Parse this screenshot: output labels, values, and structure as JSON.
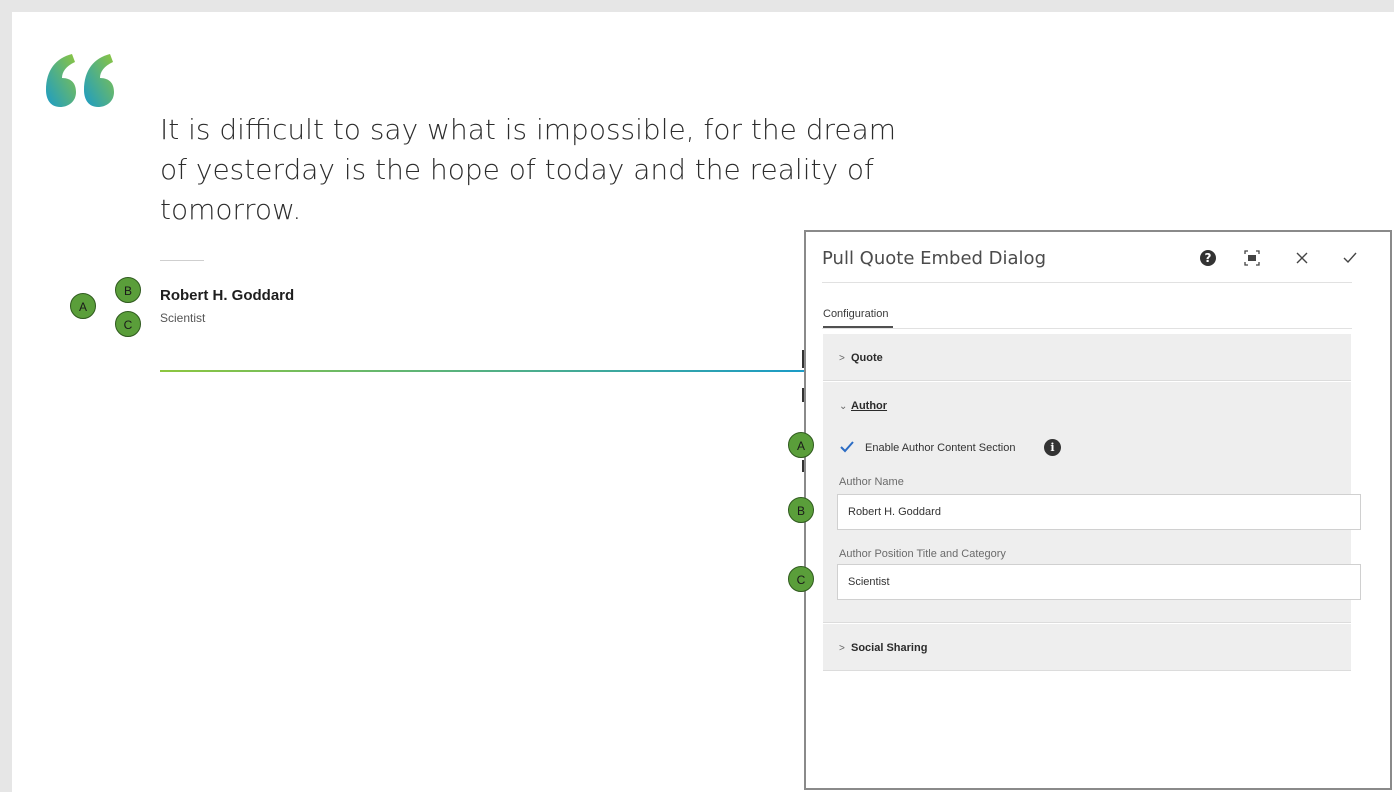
{
  "quote": {
    "text": "It is difficult to say what is impossible, for the dream of yesterday is the hope of today and the reality of tomorrow.",
    "author_name": "Robert H. Goddard",
    "author_title": "Scientist"
  },
  "callouts": {
    "a": "A",
    "b": "B",
    "c": "C"
  },
  "dialog": {
    "title": "Pull Quote Embed Dialog",
    "icons": {
      "help": "help-icon",
      "fullscreen": "fullscreen-icon",
      "close": "close-icon",
      "done": "checkmark-icon"
    },
    "tab": "Configuration",
    "sections": {
      "quote": "Quote",
      "author": "Author",
      "social": "Social Sharing"
    },
    "author_section": {
      "enable_label": "Enable Author Content Section",
      "enable_checked": true,
      "name_label": "Author Name",
      "name_value": "Robert H. Goddard",
      "position_label": "Author Position Title and Category",
      "position_value": "Scientist"
    }
  },
  "colors": {
    "quote_gradient_start": "#1a9bc8",
    "quote_gradient_end": "#8dc63f",
    "badge": "#5a9e3a",
    "checkbox": "#2b6cc4"
  }
}
